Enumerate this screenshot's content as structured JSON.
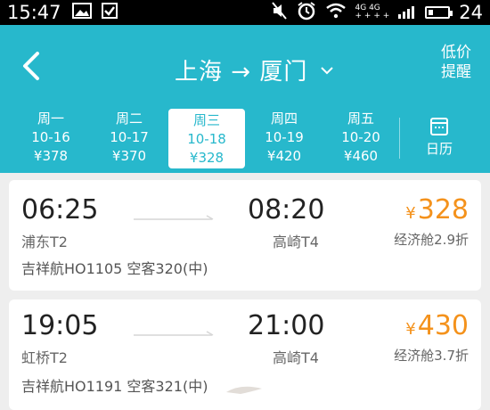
{
  "status_bar": {
    "time": "15:47",
    "net_line1": "4G 4G",
    "net_line2": "+ + + +",
    "battery_text": "24"
  },
  "header": {
    "route_text": "上海 → 厦门",
    "low_price_line1": "低价",
    "low_price_line2": "提醒",
    "calendar_label": "日历",
    "accent_color": "#27b8cc"
  },
  "dates": [
    {
      "weekday": "周一",
      "date": "10-16",
      "price": "¥378",
      "active": false
    },
    {
      "weekday": "周二",
      "date": "10-17",
      "price": "¥370",
      "active": false
    },
    {
      "weekday": "周三",
      "date": "10-18",
      "price": "¥328",
      "active": true
    },
    {
      "weekday": "周四",
      "date": "10-19",
      "price": "¥420",
      "active": false
    },
    {
      "weekday": "周五",
      "date": "10-20",
      "price": "¥460",
      "active": false
    }
  ],
  "flights": [
    {
      "dep_time": "06:25",
      "dep_airport": "浦东T2",
      "arr_time": "08:20",
      "arr_airport": "高崎T4",
      "price_symbol": "¥",
      "price": "328",
      "cabin": "经济舱2.9折",
      "info": "吉祥航HO1105 空客320(中)"
    },
    {
      "dep_time": "19:05",
      "dep_airport": "虹桥T2",
      "arr_time": "21:00",
      "arr_airport": "高崎T4",
      "price_symbol": "¥",
      "price": "430",
      "cabin": "经济舱3.7折",
      "info": "吉祥航HO1191 空客321(中)"
    }
  ],
  "icons": [
    "image-icon",
    "checkbox-icon",
    "mute-icon",
    "alarm-icon",
    "wifi-icon",
    "signal-icon",
    "battery-icon",
    "back-arrow-icon",
    "chevron-down-icon",
    "calendar-icon"
  ],
  "price_color": "#f4921c"
}
